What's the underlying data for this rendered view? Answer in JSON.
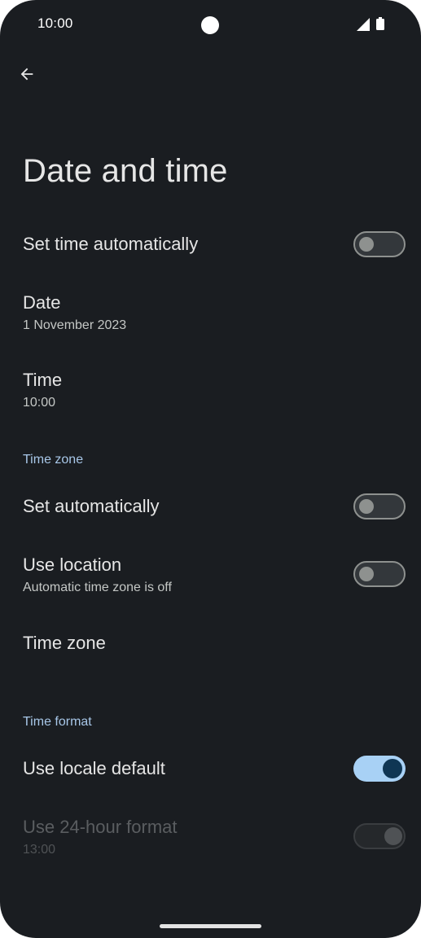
{
  "status_bar": {
    "time": "10:00",
    "icons": [
      "signal-icon",
      "battery-icon"
    ]
  },
  "toolbar": {
    "back_icon": "arrow-back-icon"
  },
  "page": {
    "title": "Date and time"
  },
  "settings": {
    "set_time_automatically": {
      "title": "Set time automatically",
      "checked": false
    },
    "date": {
      "title": "Date",
      "summary": "1 November 2023"
    },
    "time": {
      "title": "Time",
      "summary": "10:00"
    },
    "time_zone_section": {
      "header": "Time zone",
      "set_automatically": {
        "title": "Set automatically",
        "checked": false
      },
      "use_location": {
        "title": "Use location",
        "summary": "Automatic time zone is off",
        "checked": false
      },
      "time_zone": {
        "title": "Time zone"
      }
    },
    "time_format_section": {
      "header": "Time format",
      "use_locale_default": {
        "title": "Use locale default",
        "checked": true
      },
      "use_24_hour_format": {
        "title": "Use 24-hour format",
        "summary": "13:00",
        "checked": true,
        "enabled": false
      }
    }
  },
  "colors": {
    "background": "#1a1d21",
    "accent": "#a8c7e8",
    "switch_on_track": "#a8d1f5",
    "switch_on_thumb": "#0f3654"
  }
}
